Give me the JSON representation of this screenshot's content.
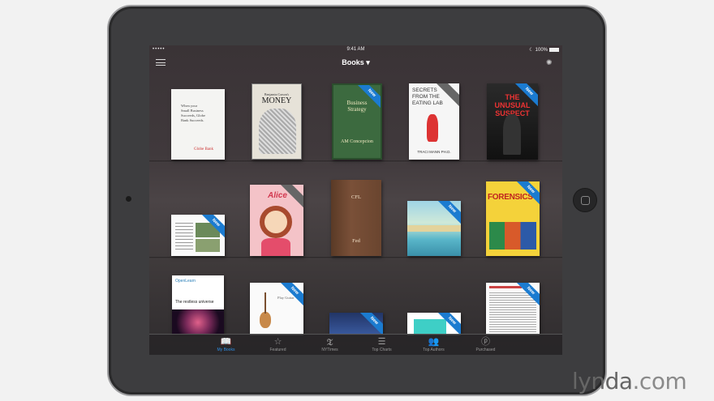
{
  "status": {
    "signal": "••••• ",
    "time": "9:41 AM",
    "battery": "100%"
  },
  "nav": {
    "title": "Books ▾"
  },
  "books": [
    {
      "lines": [
        "When your",
        "Small Business",
        "Succeeds, Globe",
        "Bank Succeeds."
      ],
      "footer": "Globe Bank",
      "ribbon": ""
    },
    {
      "lines": [
        "Benjamin Carson's"
      ],
      "title": "MONEY",
      "ribbon": ""
    },
    {
      "title": "Business Strategy",
      "author": "AM Concepcion",
      "ribbon": "New"
    },
    {
      "title": "SECRETS FROM THE EATING LAB",
      "author": "TRACI MANN PH.D.",
      "ribbon": ""
    },
    {
      "title": "THE UNUSUAL SUSPECT",
      "ribbon": "New"
    },
    {
      "ribbon": "New"
    },
    {
      "title": "Alice",
      "ribbon": ""
    },
    {
      "title": "CFL",
      "author": "Fed",
      "ribbon": ""
    },
    {
      "ribbon": "New"
    },
    {
      "title": "FORENSICS",
      "ribbon": "New"
    },
    {
      "brand": "OpenLearn",
      "title": "The restless universe",
      "ribbon": ""
    },
    {
      "title": "Play Guitar",
      "ribbon": "New"
    },
    {
      "ribbon": "New"
    },
    {
      "ribbon": "New"
    },
    {
      "ribbon": "New"
    }
  ],
  "tabs": [
    {
      "label": "My Books",
      "icon": "open-book-icon"
    },
    {
      "label": "Featured",
      "icon": "star-icon"
    },
    {
      "label": "NYTimes",
      "icon": "nytimes-icon"
    },
    {
      "label": "Top Charts",
      "icon": "list-icon"
    },
    {
      "label": "Top Authors",
      "icon": "people-icon"
    },
    {
      "label": "Purchased",
      "icon": "purchased-icon"
    }
  ],
  "watermark": {
    "brand": "lynda",
    "suffix": ".com"
  }
}
